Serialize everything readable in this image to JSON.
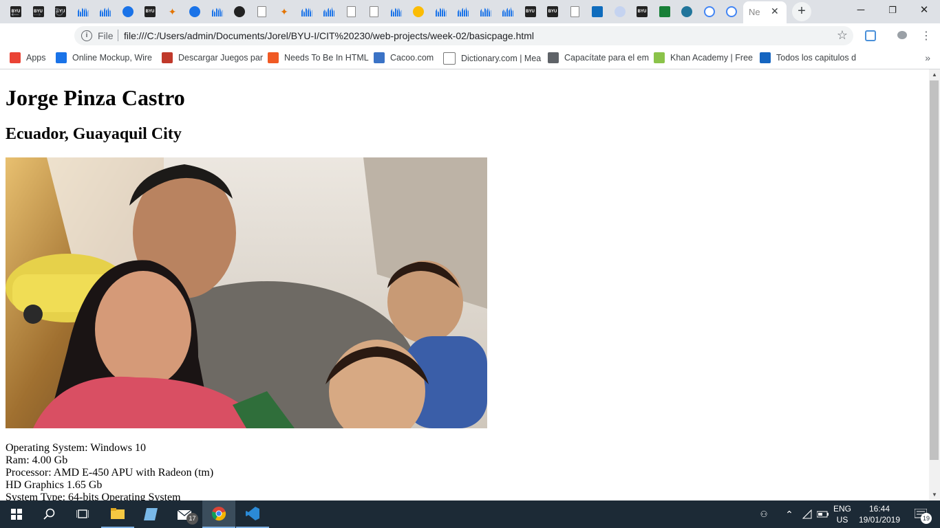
{
  "browser": {
    "tab_title": "Ne",
    "tab_close": "✕",
    "new_tab": "+",
    "tab_favicons": [
      "byu",
      "byu",
      "byu",
      "bars",
      "bars",
      "dark",
      "byu",
      "cross",
      "dark",
      "bars",
      "gh",
      "doc",
      "cross",
      "bars",
      "bars",
      "doc",
      "doc",
      "bars",
      "yellow",
      "bars",
      "bars",
      "bars",
      "bars",
      "byu",
      "byu",
      "doc",
      "outlook",
      "globe",
      "byu",
      "sheets",
      "wp",
      "google",
      "google"
    ],
    "window_controls": {
      "minimize": "─",
      "maximize": "❐",
      "close": "✕"
    },
    "address": {
      "scheme": "File",
      "url": "file:///C:/Users/admin/Documents/Jorel/BYU-I/CIT%20230/web-projects/week-02/basicpage.html"
    },
    "bookmarks": [
      {
        "label": "Apps",
        "icon": "apps-grid",
        "color": "#ea4335"
      },
      {
        "label": "Online Mockup, Wire",
        "icon": "moqups-m",
        "color": "#1a73e8"
      },
      {
        "label": "Descargar Juegos par",
        "icon": "gt-logo",
        "color": "#c0392b"
      },
      {
        "label": "Needs To Be In HTML",
        "icon": "codecademy-c",
        "color": "#f05a24"
      },
      {
        "label": "Cacoo.com",
        "icon": "cacoo-c",
        "color": "#3b73c6"
      },
      {
        "label": "Dictionary.com | Mea",
        "icon": "page",
        "color": "#ffffff"
      },
      {
        "label": "Capacítate para el em",
        "icon": "edit",
        "color": "#5f6368"
      },
      {
        "label": "Khan Academy | Free",
        "icon": "leaf",
        "color": "#8bc34a"
      },
      {
        "label": "Todos los capitulos d",
        "icon": "d-logo",
        "color": "#1565c0"
      }
    ],
    "bookmarks_more": "»"
  },
  "page": {
    "title": "Jorge Pinza Castro",
    "subtitle": "Ecuador, Guayaquil City",
    "specs": [
      "Operating System: Windows 10",
      "Ram: 4.00 Gb",
      "Processor: AMD E-450 APU with Radeon (tm)",
      "HD Graphics 1.65 Gb",
      "System Type: 64-bits Operating System"
    ]
  },
  "taskbar": {
    "mail_badge": "17",
    "lang_top": "ENG",
    "lang_bottom": "US",
    "time": "16:44",
    "date": "19/01/2019",
    "notif_count": "19"
  }
}
